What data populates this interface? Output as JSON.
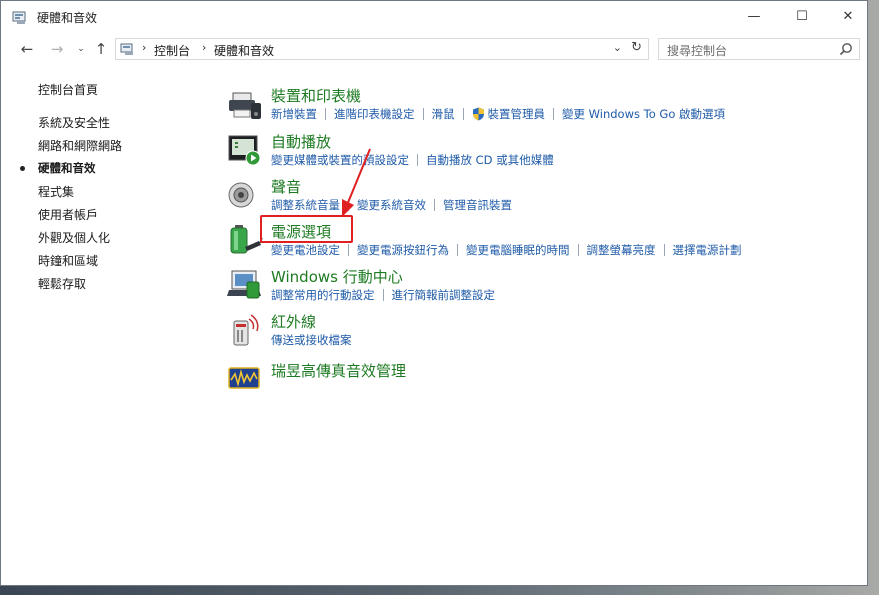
{
  "window": {
    "title": "硬體和音效",
    "controls": {
      "minimize": "—",
      "maximize": "☐",
      "close": "✕"
    }
  },
  "address": {
    "crumbs": [
      "控制台",
      "硬體和音效"
    ],
    "search_placeholder": "搜尋控制台"
  },
  "sidebar": {
    "items": [
      {
        "label": "控制台首頁",
        "current": false
      },
      {
        "label": "系統及安全性",
        "current": false
      },
      {
        "label": "網路和網際網路",
        "current": false
      },
      {
        "label": "硬體和音效",
        "current": true
      },
      {
        "label": "程式集",
        "current": false
      },
      {
        "label": "使用者帳戶",
        "current": false
      },
      {
        "label": "外觀及個人化",
        "current": false
      },
      {
        "label": "時鐘和區域",
        "current": false
      },
      {
        "label": "輕鬆存取",
        "current": false
      }
    ]
  },
  "categories": [
    {
      "title": "裝置和印表機",
      "icon": "devices-printers-icon",
      "links": [
        "新增裝置",
        "進階印表機設定",
        "滑鼠",
        "裝置管理員",
        "變更 Windows To Go 啟動選項"
      ]
    },
    {
      "title": "自動播放",
      "icon": "autoplay-icon",
      "links": [
        "變更媒體或裝置的預設設定",
        "自動播放 CD 或其他媒體"
      ]
    },
    {
      "title": "聲音",
      "icon": "sound-speaker-icon",
      "links": [
        "調整系統音量",
        "變更系統音效",
        "管理音訊裝置"
      ]
    },
    {
      "title": "電源選項",
      "icon": "power-options-battery-icon",
      "links": [
        "變更電池設定",
        "變更電源按鈕行為",
        "變更電腦睡眠的時間",
        "調整螢幕亮度",
        "選擇電源計劃"
      ]
    },
    {
      "title": "Windows 行動中心",
      "icon": "mobility-center-icon",
      "links": [
        "調整常用的行動設定",
        "進行簡報前調整設定"
      ]
    },
    {
      "title": "紅外線",
      "icon": "infrared-icon",
      "links": [
        "傳送或接收檔案"
      ]
    },
    {
      "title": "瑞昱高傳真音效管理",
      "icon": "realtek-audio-icon",
      "links": []
    }
  ],
  "colors": {
    "category_title": "#1e7b23",
    "link": "#1f5ba8",
    "annotation": "#e02020"
  }
}
